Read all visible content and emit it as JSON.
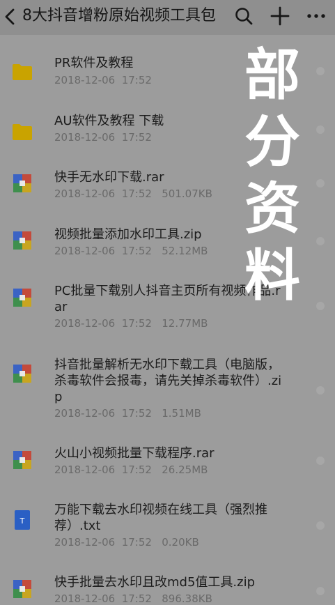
{
  "header": {
    "title": "8大抖音增粉原始视频工具包",
    "icons": [
      "back-icon",
      "search-icon",
      "add-icon",
      "more-icon"
    ]
  },
  "files": [
    {
      "name": "PR软件及教程",
      "date": "2018-12-06  17:52",
      "size": "",
      "type": "folder"
    },
    {
      "name": "AU软件及教程 下载",
      "date": "2018-12-06  17:52",
      "size": "",
      "type": "folder"
    },
    {
      "name": "快手无水印下载.rar",
      "date": "2018-12-06  17:52",
      "size": "501.07KB",
      "type": "archive"
    },
    {
      "name": "视频批量添加水印工具.zip",
      "date": "2018-12-06  17:52",
      "size": "52.12MB",
      "type": "archive"
    },
    {
      "name": "PC批量下载别人抖音主页所有视频作品.rar",
      "date": "2018-12-06  17:52",
      "size": "12.77MB",
      "type": "archive"
    },
    {
      "name": "抖音批量解析无水印下载工具（电脑版，杀毒软件会报毒，请先关掉杀毒软件）.zip",
      "date": "2018-12-06  17:52",
      "size": "1.51MB",
      "type": "archive"
    },
    {
      "name": "火山小视频批量下载程序.rar",
      "date": "2018-12-06  17:52",
      "size": "26.25MB",
      "type": "archive"
    },
    {
      "name": "万能下载去水印视频在线工具（强烈推荐）.txt",
      "date": "2018-12-06  17:52",
      "size": "0.20KB",
      "type": "text"
    },
    {
      "name": "快手批量去水印且改md5值工具.zip",
      "date": "2018-12-06  17:52",
      "size": "896.38KB",
      "type": "archive"
    }
  ],
  "overlay": {
    "text": "部\n分\n资\n料"
  },
  "colors": {
    "folder": "#c9a300",
    "archive_blue": "#3b63c4",
    "archive_red": "#c44a3b",
    "archive_green": "#3f8f4d",
    "archive_yellow": "#c8a520",
    "text_file": "#2a5fc4"
  }
}
